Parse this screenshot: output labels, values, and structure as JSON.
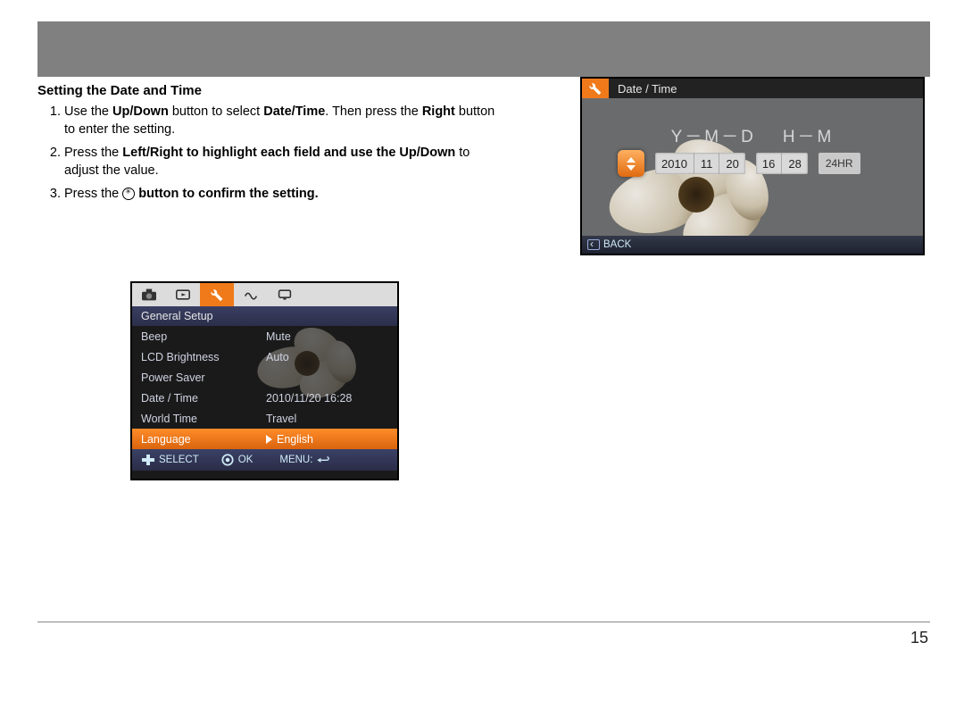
{
  "heading": "Setting the Date and Time",
  "instructions": [
    {
      "pre": "Use the ",
      "b1": "Up/Down",
      "mid1": " button to select ",
      "b2": "Date/Time",
      "mid2": ". Then press the ",
      "b3": "Right",
      "post": " button to enter the setting."
    },
    {
      "pre": "Press the ",
      "b1": "Left/Right to highlight each field and use the Up/Down",
      "post": " to adjust the value."
    },
    {
      "pre": "Press the ",
      "icon": true,
      "post": " button to confirm the setting."
    }
  ],
  "setup_menu": {
    "title": "General Setup",
    "rows": [
      {
        "label": "Beep",
        "value": "Mute"
      },
      {
        "label": "LCD Brightness",
        "value": "Auto"
      },
      {
        "label": "Power Saver",
        "value": ""
      },
      {
        "label": "Date / Time",
        "value": "2010/11/20 16:28"
      },
      {
        "label": "World Time",
        "value": "Travel"
      },
      {
        "label": "Language",
        "value": "English",
        "highlight": true
      }
    ],
    "footer": {
      "select": "SELECT",
      "ok": "OK",
      "menu": "MENU:"
    }
  },
  "datetime": {
    "title": "Date / Time",
    "format_ymd": "Y－M－D",
    "format_hm": "H－M",
    "year": "2010",
    "month": "11",
    "day": "20",
    "hour": "16",
    "minute": "28",
    "mode": "24HR",
    "back": "BACK"
  },
  "page_number": "15"
}
